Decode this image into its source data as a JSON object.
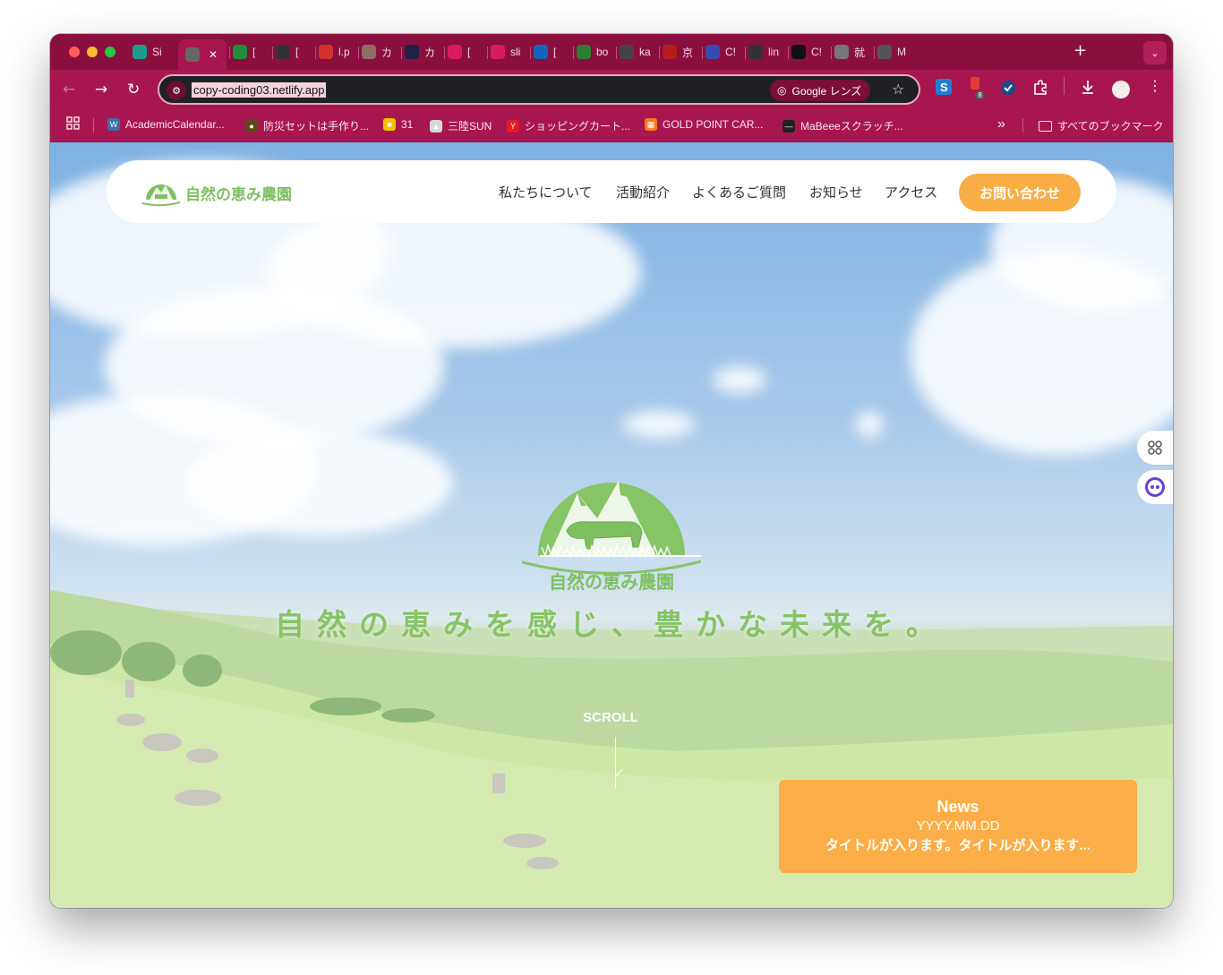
{
  "browser": {
    "tabs": [
      {
        "label": "Si",
        "fav": "#1a9b8e"
      },
      {
        "label": "",
        "fav": "#666666",
        "active": true
      },
      {
        "label": "[",
        "fav": "#1e8e3e"
      },
      {
        "label": "[",
        "fav": "#333333"
      },
      {
        "label": "l.p",
        "fav": "#d32f2f"
      },
      {
        "label": "カ",
        "fav": "#8d6e63"
      },
      {
        "label": "カ",
        "fav": "#222244"
      },
      {
        "label": "[",
        "fav": "#d81b60"
      },
      {
        "label": "sli",
        "fav": "#d81b60"
      },
      {
        "label": "[",
        "fav": "#1565c0"
      },
      {
        "label": "bo",
        "fav": "#2e7d32"
      },
      {
        "label": "ka",
        "fav": "#444444"
      },
      {
        "label": "京",
        "fav": "#b71c1c"
      },
      {
        "label": "C!",
        "fav": "#3949ab"
      },
      {
        "label": "lin",
        "fav": "#333333"
      },
      {
        "label": "C!",
        "fav": "#111111"
      },
      {
        "label": "就",
        "fav": "#777777"
      },
      {
        "label": "M",
        "fav": "#555555"
      }
    ],
    "close_tab": "✕",
    "new_tab": "+",
    "tab_menu": "⌄",
    "url": "copy-coding03.netlify.app",
    "lens_label": "Google レンズ",
    "extension_badge": "8",
    "bookmarks": [
      {
        "label": "AcademicCalendar...",
        "color": "#3a6ea5",
        "glyph": "W"
      },
      {
        "label": "防災セットは手作り...",
        "color": "#5b4a1f",
        "glyph": "●"
      },
      {
        "label": "31",
        "color": "#f2c200",
        "glyph": "■"
      },
      {
        "label": "三陸SUN",
        "color": "#d8d8d8",
        "glyph": "▲"
      },
      {
        "label": "ショッピングカート...",
        "color": "#e51b23",
        "glyph": "Y"
      },
      {
        "label": "GOLD POINT CAR...",
        "color": "#f47b20",
        "glyph": "▦"
      },
      {
        "label": "MaBeeeスクラッチ...",
        "color": "#222222",
        "glyph": "—"
      }
    ],
    "bookmarks_overflow": "»",
    "all_bookmarks": "すべてのブックマーク"
  },
  "site": {
    "logo_text": "自然の恵み農園",
    "nav": [
      "私たちについて",
      "活動紹介",
      "よくあるご質問",
      "お知らせ",
      "アクセス"
    ],
    "cta": "お問い合わせ",
    "hero_logo_text": "自然の恵み農園",
    "tagline": "自然の恵みを感じ、豊かな未来を。",
    "scroll": "SCROLL",
    "news": {
      "title": "News",
      "date": "YYYY.MM.DD",
      "text": "タイトルが入ります。タイトルが入ります..."
    },
    "brand_color": "#7fbf62",
    "accent_color": "#f8ae45"
  }
}
